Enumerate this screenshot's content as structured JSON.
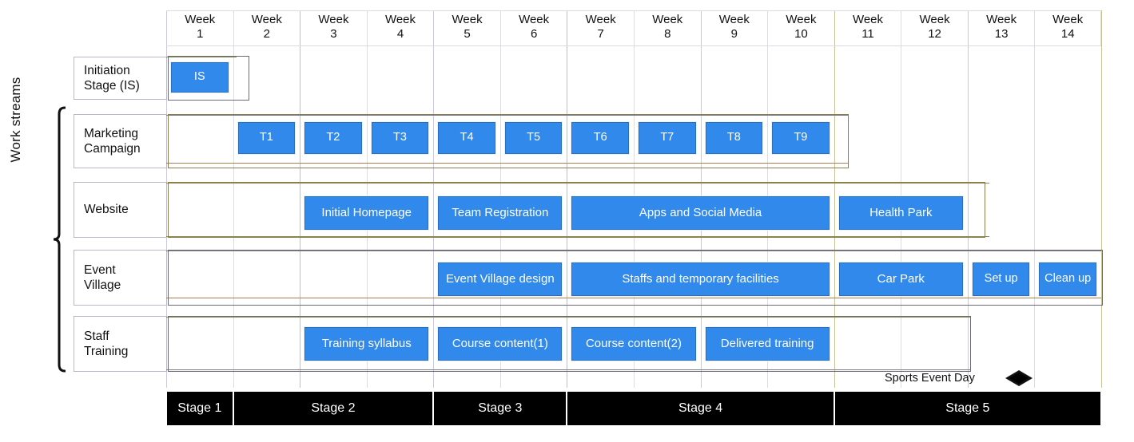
{
  "axis": {
    "label": "Work streams",
    "weeks": [
      {
        "line1": "Week",
        "line2": "1"
      },
      {
        "line1": "Week",
        "line2": "2"
      },
      {
        "line1": "Week",
        "line2": "3"
      },
      {
        "line1": "Week",
        "line2": "4"
      },
      {
        "line1": "Week",
        "line2": "5"
      },
      {
        "line1": "Week",
        "line2": "6"
      },
      {
        "line1": "Week",
        "line2": "7"
      },
      {
        "line1": "Week",
        "line2": "8"
      },
      {
        "line1": "Week",
        "line2": "9"
      },
      {
        "line1": "Week",
        "line2": "10"
      },
      {
        "line1": "Week",
        "line2": "11"
      },
      {
        "line1": "Week",
        "line2": "12"
      },
      {
        "line1": "Week",
        "line2": "13"
      },
      {
        "line1": "Week",
        "line2": "14"
      }
    ]
  },
  "rows": [
    {
      "id": "initiation",
      "label_line1": "Initiation",
      "label_line2": "Stage (IS)"
    },
    {
      "id": "marketing",
      "label_line1": "Marketing",
      "label_line2": "Campaign"
    },
    {
      "id": "website",
      "label_line1": "Website",
      "label_line2": ""
    },
    {
      "id": "event-village",
      "label_line1": "Event",
      "label_line2": "Village"
    },
    {
      "id": "staff-training",
      "label_line1": "Staff",
      "label_line2": "Training"
    }
  ],
  "milestone": {
    "label": "Sports Event Day",
    "week": 13
  },
  "stages": [
    {
      "label": "Stage 1",
      "start_week": 1,
      "end_week": 1
    },
    {
      "label": "Stage 2",
      "start_week": 2,
      "end_week": 4
    },
    {
      "label": "Stage 3",
      "start_week": 5,
      "end_week": 6
    },
    {
      "label": "Stage 4",
      "start_week": 7,
      "end_week": 10
    },
    {
      "label": "Stage 5",
      "start_week": 11,
      "end_week": 14
    }
  ],
  "colors": {
    "bar_fill": "#3189ec",
    "bar_border": "#2b6fbd",
    "stage_fill": "#000000",
    "grid": "#dcdce4",
    "olive_rule": "#8d8a4d",
    "brown_rule": "#a97f51"
  },
  "chart_data": {
    "type": "bar",
    "title": "",
    "xlabel": "",
    "ylabel": "Work streams",
    "categories": [
      "Week 1",
      "Week 2",
      "Week 3",
      "Week 4",
      "Week 5",
      "Week 6",
      "Week 7",
      "Week 8",
      "Week 9",
      "Week 10",
      "Week 11",
      "Week 12",
      "Week 13",
      "Week 14"
    ],
    "xlim": [
      1,
      14
    ],
    "grid": true,
    "legend": "none",
    "series": [
      {
        "name": "Initiation Stage (IS)",
        "tasks": [
          {
            "label": "IS",
            "start_week": 1,
            "end_week": 1,
            "duration_weeks": 1
          }
        ]
      },
      {
        "name": "Marketing Campaign",
        "tasks": [
          {
            "label": "T1",
            "start_week": 2,
            "end_week": 2,
            "duration_weeks": 1
          },
          {
            "label": "T2",
            "start_week": 3,
            "end_week": 3,
            "duration_weeks": 1
          },
          {
            "label": "T3",
            "start_week": 4,
            "end_week": 4,
            "duration_weeks": 1
          },
          {
            "label": "T4",
            "start_week": 5,
            "end_week": 5,
            "duration_weeks": 1
          },
          {
            "label": "T5",
            "start_week": 6,
            "end_week": 6,
            "duration_weeks": 1
          },
          {
            "label": "T6",
            "start_week": 7,
            "end_week": 7,
            "duration_weeks": 1
          },
          {
            "label": "T7",
            "start_week": 8,
            "end_week": 8,
            "duration_weeks": 1
          },
          {
            "label": "T8",
            "start_week": 9,
            "end_week": 9,
            "duration_weeks": 1
          },
          {
            "label": "T9",
            "start_week": 10,
            "end_week": 10,
            "duration_weeks": 1
          }
        ]
      },
      {
        "name": "Website",
        "tasks": [
          {
            "label": "Initial Homepage",
            "start_week": 3,
            "end_week": 4,
            "duration_weeks": 2
          },
          {
            "label": "Team Registration",
            "start_week": 5,
            "end_week": 6,
            "duration_weeks": 2
          },
          {
            "label": "Apps and Social Media",
            "start_week": 7,
            "end_week": 10,
            "duration_weeks": 4
          },
          {
            "label": "Health Park",
            "start_week": 11,
            "end_week": 12,
            "duration_weeks": 2
          }
        ]
      },
      {
        "name": "Event Village",
        "tasks": [
          {
            "label": "Event Village design",
            "start_week": 5,
            "end_week": 6,
            "duration_weeks": 2
          },
          {
            "label": "Staffs and temporary facilities",
            "start_week": 7,
            "end_week": 10,
            "duration_weeks": 4
          },
          {
            "label": "Car Park",
            "start_week": 11,
            "end_week": 12,
            "duration_weeks": 2
          },
          {
            "label": "Set up",
            "start_week": 13,
            "end_week": 13,
            "duration_weeks": 1
          },
          {
            "label": "Clean up",
            "start_week": 14,
            "end_week": 14,
            "duration_weeks": 1
          }
        ]
      },
      {
        "name": "Staff Training",
        "tasks": [
          {
            "label": "Training syllabus",
            "start_week": 3,
            "end_week": 4,
            "duration_weeks": 2
          },
          {
            "label": "Course content(1)",
            "start_week": 5,
            "end_week": 6,
            "duration_weeks": 2
          },
          {
            "label": "Course content(2)",
            "start_week": 7,
            "end_week": 8,
            "duration_weeks": 2
          },
          {
            "label": "Delivered training",
            "start_week": 9,
            "end_week": 10,
            "duration_weeks": 2
          }
        ]
      }
    ],
    "milestones": [
      {
        "label": "Sports Event Day",
        "week": 13
      }
    ],
    "stages": [
      {
        "label": "Stage 1",
        "start_week": 1,
        "end_week": 1
      },
      {
        "label": "Stage 2",
        "start_week": 2,
        "end_week": 4
      },
      {
        "label": "Stage 3",
        "start_week": 5,
        "end_week": 6
      },
      {
        "label": "Stage 4",
        "start_week": 7,
        "end_week": 10
      },
      {
        "label": "Stage 5",
        "start_week": 11,
        "end_week": 14
      }
    ]
  }
}
